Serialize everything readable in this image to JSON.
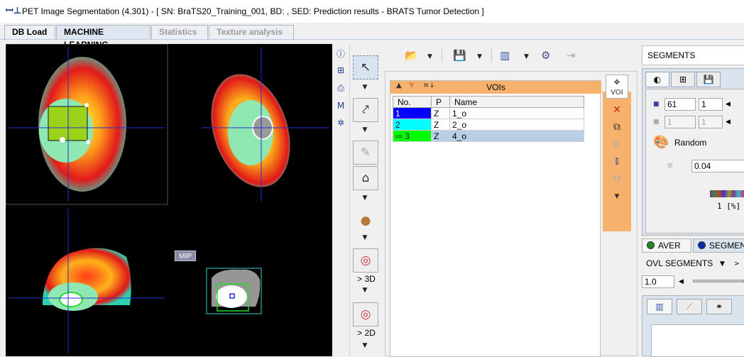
{
  "window": {
    "icon": "pmod-logo-icon",
    "title": "PET Image Segmentation (4.301) - [ SN: BraTS20_Training_001, BD: , SED: Prediction results - BRATS Tumor Detection ]"
  },
  "tabs": [
    {
      "label": "DB Load",
      "state": "normal"
    },
    {
      "label": "MACHINE LEARNING",
      "state": "active"
    },
    {
      "label": "Statistics",
      "state": "disabled"
    },
    {
      "label": "Texture analysis",
      "state": "disabled"
    }
  ],
  "viewer": {
    "mip_label": "MIP"
  },
  "tools": {
    "to_3d_label": "> 3D",
    "to_2d_label": "> 2D"
  },
  "voi_panel": {
    "header_title": "VOIs",
    "columns": [
      "No.",
      "P",
      "Name"
    ],
    "rows": [
      {
        "no": "1",
        "p": "Z",
        "name": "1_o",
        "color": "#0000ff",
        "selected": false
      },
      {
        "no": "2",
        "p": "Z",
        "name": "2_o",
        "color": "#00ffff",
        "selected": false
      },
      {
        "no": "3",
        "p": "Z",
        "name": "4_o",
        "color": "#00ff00",
        "selected": true
      }
    ],
    "voi_button_label": "VOI"
  },
  "segments_panel": {
    "title": "SEGMENTS",
    "value_a": "61",
    "value_b": "1",
    "value_c": "1",
    "value_d": "1",
    "color_mode": "Random",
    "threshold": "0.04",
    "unit_readout": "1 [%]",
    "bottom_tabs": [
      {
        "label": "AVER",
        "dot_color": "#1e8a1e"
      },
      {
        "label": "SEGMEN",
        "dot_color": "#0a2ab0"
      }
    ],
    "ovl_label": "OVL SEGMENTS",
    "ovl_value": "1.0"
  },
  "colors": {
    "accent_orange": "#f6b16c",
    "selection_blue": "#b8cfe6",
    "panel_blue": "#dae4ee"
  }
}
